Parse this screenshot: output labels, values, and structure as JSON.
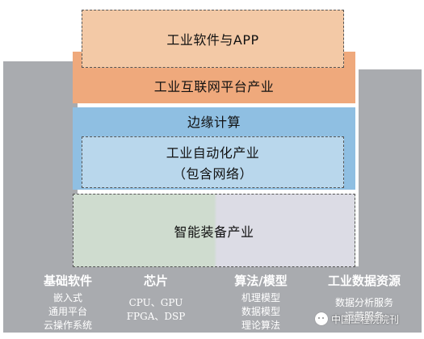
{
  "layers": {
    "software": "工业软件与APP",
    "platform": "工业互联网平台产业",
    "edge": "边缘计算",
    "automation_line1": "工业自动化产业",
    "automation_line2": "（包含网络）",
    "equipment": "智能装备产业"
  },
  "foundation": {
    "columns": [
      {
        "title": "基础软件",
        "items": [
          "嵌入式",
          "通用平台",
          "云操作系统"
        ]
      },
      {
        "title": "芯片",
        "items": [
          "CPU、GPU",
          "FPGA、DSP"
        ]
      },
      {
        "title": "算法/模型",
        "items": [
          "机理模型",
          "数据模型",
          "理论算法"
        ]
      },
      {
        "title": "工业数据资源",
        "items": [
          "数据分析服务",
          "运营服务"
        ]
      }
    ]
  },
  "watermark": {
    "text": "中国工程院院刊"
  },
  "colors": {
    "software_fill": "#f3c9a6",
    "platform_fill": "#efa97c",
    "edge_fill": "#8fbfe2",
    "automation_fill": "#b9d7ec",
    "equipment_fill_left": "#cfdccf",
    "equipment_fill_right": "#dcdce5",
    "base_gray": "#a9abaf"
  }
}
